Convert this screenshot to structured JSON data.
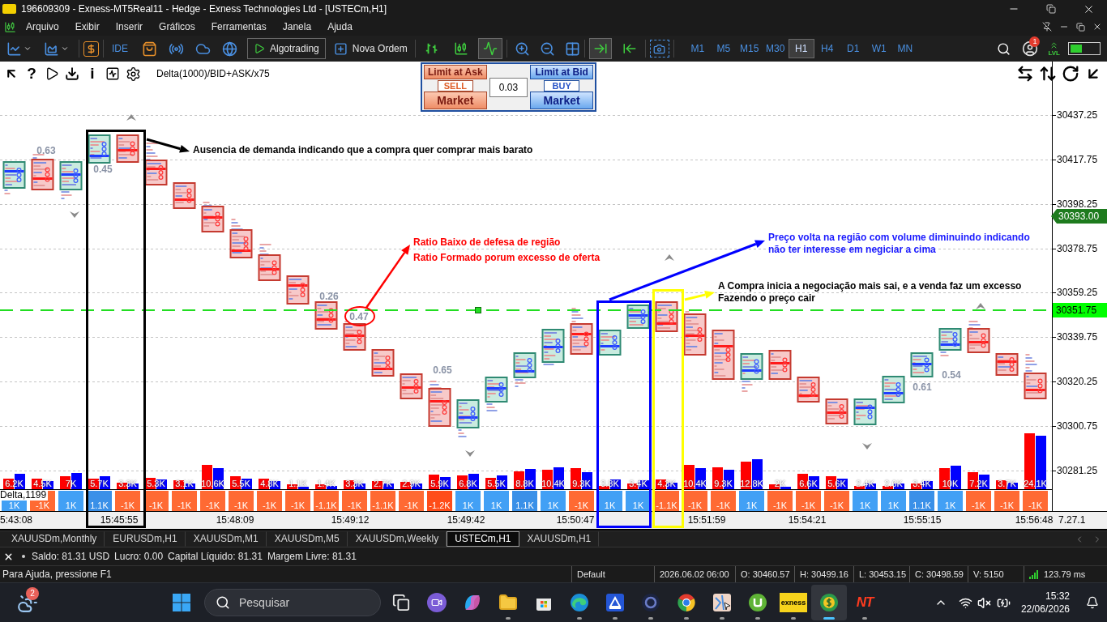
{
  "window": {
    "title": "196609309 - Exness-MT5Real11 - Hedge - Exness Technologies Ltd - [USTECm,H1]"
  },
  "menu": [
    "Arquivo",
    "Exibir",
    "Inserir",
    "Gráficos",
    "Ferramentas",
    "Janela",
    "Ajuda"
  ],
  "toolbar": {
    "ide": "IDE",
    "algotrading": "Algotrading",
    "new_order": "Nova Ordem",
    "chart_types": [
      {
        "kind": "bars",
        "selected": false
      },
      {
        "kind": "candles",
        "selected": false
      },
      {
        "kind": "line",
        "selected": true
      }
    ],
    "toggles": [
      {
        "kind": "shift",
        "selected": true
      },
      {
        "kind": "autoscroll",
        "selected": false
      }
    ],
    "timeframes": [
      {
        "label": "M1",
        "selected": false
      },
      {
        "label": "M5",
        "selected": false
      },
      {
        "label": "M15",
        "selected": false
      },
      {
        "label": "M30",
        "selected": false
      },
      {
        "label": "H1",
        "selected": true
      },
      {
        "label": "H4",
        "selected": false
      },
      {
        "label": "D1",
        "selected": false
      },
      {
        "label": "W1",
        "selected": false
      },
      {
        "label": "MN",
        "selected": false
      }
    ],
    "notification_count": "1",
    "level_label": "LVL"
  },
  "chart": {
    "help_glyph": "?",
    "info_glyph": "i",
    "indicator_label": "Delta(1000)/BID+ASK/x75",
    "trade_panel": {
      "sell_limit": "Limit at Ask",
      "sell": "SELL",
      "sell_market": "Market",
      "lot": "0.03",
      "buy_limit": "Limit at Bid",
      "buy": "BUY",
      "buy_market": "Market"
    },
    "price_axis": [
      {
        "label": "30437.25",
        "kind": "tick"
      },
      {
        "label": "30417.75",
        "kind": "tick"
      },
      {
        "label": "30398.25",
        "kind": "tick"
      },
      {
        "label": "30393.00",
        "kind": "bid"
      },
      {
        "label": "30378.75",
        "kind": "tick"
      },
      {
        "label": "30359.25",
        "kind": "tick"
      },
      {
        "label": "30351.75",
        "kind": "line"
      },
      {
        "label": "30339.75",
        "kind": "tick"
      },
      {
        "label": "30320.25",
        "kind": "tick"
      },
      {
        "label": "30300.75",
        "kind": "tick"
      },
      {
        "label": "30281.25",
        "kind": "tick"
      }
    ],
    "candles": [
      {
        "kind": "up"
      },
      {
        "kind": "down",
        "ratio": "0.63"
      },
      {
        "kind": "up"
      },
      {
        "kind": "up",
        "ratio": "0.45"
      },
      {
        "kind": "down"
      },
      {
        "kind": "down"
      },
      {
        "kind": "down"
      },
      {
        "kind": "down"
      },
      {
        "kind": "down"
      },
      {
        "kind": "down"
      },
      {
        "kind": "down"
      },
      {
        "kind": "down",
        "ratio": "0.26"
      },
      {
        "kind": "down",
        "ratio": "0.47"
      },
      {
        "kind": "down"
      },
      {
        "kind": "down"
      },
      {
        "kind": "down",
        "ratio": "0.65"
      },
      {
        "kind": "up"
      },
      {
        "kind": "up"
      },
      {
        "kind": "up"
      },
      {
        "kind": "up"
      },
      {
        "kind": "down"
      },
      {
        "kind": "up"
      },
      {
        "kind": "up"
      },
      {
        "kind": "down"
      },
      {
        "kind": "down"
      },
      {
        "kind": "down"
      },
      {
        "kind": "up"
      },
      {
        "kind": "down"
      },
      {
        "kind": "down"
      },
      {
        "kind": "down"
      },
      {
        "kind": "up"
      },
      {
        "kind": "up"
      },
      {
        "kind": "up",
        "ratio": "0.61"
      },
      {
        "kind": "up",
        "ratio": "0.54"
      },
      {
        "kind": "down"
      },
      {
        "kind": "down"
      },
      {
        "kind": "down"
      }
    ],
    "signals": [
      {
        "kind": "down"
      },
      {
        "kind": "up"
      },
      {
        "kind": "down"
      },
      {
        "kind": "up"
      },
      {
        "kind": "down"
      },
      {
        "kind": "up"
      }
    ],
    "annotations": [
      {
        "lines": [
          "Ausencia de demanda indicando que a compra quer comprar mais barato"
        ],
        "color": "#000000"
      },
      {
        "lines": [
          "Ratio Baixo de defesa de região",
          "Ratio Formado porum excesso de oferta"
        ],
        "color": "#ff0000"
      },
      {
        "lines": [
          "Preço volta na região com volume diminuindo indicando",
          "não ter interesse em negiciar a cima"
        ],
        "color": "#1a1aff"
      },
      {
        "lines": [
          "A Compra inicia a negociação mais sai, e a venda faz um excesso",
          "Fazendo o preço cair"
        ],
        "color": "#000000"
      }
    ],
    "volume": [
      {
        "label": "6.2K"
      },
      {
        "label": "4.5K"
      },
      {
        "label": "7K"
      },
      {
        "label": "5.7K"
      },
      {
        "label": "3.3K"
      },
      {
        "label": "5.3K"
      },
      {
        "label": "3.1K"
      },
      {
        "label": "10.6K"
      },
      {
        "label": "5.5K"
      },
      {
        "label": "4.8K"
      },
      {
        "label": "1.1K"
      },
      {
        "label": "1.4K"
      },
      {
        "label": "3.3K"
      },
      {
        "label": "2.7K"
      },
      {
        "label": "2.9K"
      },
      {
        "label": "5.9K"
      },
      {
        "label": "6.8K"
      },
      {
        "label": "5.5K"
      },
      {
        "label": "8.8K"
      },
      {
        "label": "10.4K"
      },
      {
        "label": "9.3K"
      },
      {
        "label": "3.8K"
      },
      {
        "label": "3.4K"
      },
      {
        "label": "4.3K"
      },
      {
        "label": "10.4K"
      },
      {
        "label": "9.3K"
      },
      {
        "label": "12.8K"
      },
      {
        "label": "2K"
      },
      {
        "label": "6.6K"
      },
      {
        "label": "5.6K"
      },
      {
        "label": "2.4K"
      },
      {
        "label": "2.6K"
      },
      {
        "label": "3.4K"
      },
      {
        "label": "10K"
      },
      {
        "label": "7.2K"
      },
      {
        "label": "3.7K"
      },
      {
        "label": "24.1K"
      }
    ],
    "delta_label": "Delta,1199",
    "delta": [
      {
        "label": "1K",
        "color": "#42a0f5"
      },
      {
        "label": "-1K",
        "color": "#ff6a33"
      },
      {
        "label": "1K",
        "color": "#42a0f5"
      },
      {
        "label": "1.1K",
        "color": "#3a90e8"
      },
      {
        "label": "-1K",
        "color": "#ff6a33"
      },
      {
        "label": "-1K",
        "color": "#ff6a33"
      },
      {
        "label": "-1K",
        "color": "#ff6a33"
      },
      {
        "label": "-1K",
        "color": "#ff6a33"
      },
      {
        "label": "-1K",
        "color": "#ff6a33"
      },
      {
        "label": "-1K",
        "color": "#ff6a33"
      },
      {
        "label": "-1K",
        "color": "#ff6a33"
      },
      {
        "label": "-1.1K",
        "color": "#ff6a33"
      },
      {
        "label": "-1K",
        "color": "#ff6a33"
      },
      {
        "label": "-1.1K",
        "color": "#ff6a33"
      },
      {
        "label": "-1K",
        "color": "#ff6a33"
      },
      {
        "label": "-1.2K",
        "color": "#ff4d1a"
      },
      {
        "label": "1K",
        "color": "#42a0f5"
      },
      {
        "label": "1K",
        "color": "#42a0f5"
      },
      {
        "label": "1.1K",
        "color": "#3a90e8"
      },
      {
        "label": "1K",
        "color": "#42a0f5"
      },
      {
        "label": "-1K",
        "color": "#ff6a33"
      },
      {
        "label": "1K",
        "color": "#42a0f5"
      },
      {
        "label": "1K",
        "color": "#42a0f5"
      },
      {
        "label": "-1.1K",
        "color": "#ff6a33"
      },
      {
        "label": "-1K",
        "color": "#ff6a33"
      },
      {
        "label": "-1K",
        "color": "#ff6a33"
      },
      {
        "label": "1K",
        "color": "#42a0f5"
      },
      {
        "label": "-1K",
        "color": "#ff6a33"
      },
      {
        "label": "-1K",
        "color": "#ff6a33"
      },
      {
        "label": "-1K",
        "color": "#ff6a33"
      },
      {
        "label": "1K",
        "color": "#42a0f5"
      },
      {
        "label": "1K",
        "color": "#42a0f5"
      },
      {
        "label": "1.1K",
        "color": "#3a90e8"
      },
      {
        "label": "1K",
        "color": "#42a0f5"
      },
      {
        "label": "-1K",
        "color": "#ff6a33"
      },
      {
        "label": "-1K",
        "color": "#ff6a33"
      },
      {
        "label": "-1K",
        "color": "#ff6a33"
      }
    ],
    "time_axis": [
      "5:43:08",
      "15:45:55",
      "15:48:09",
      "15:49:12",
      "15:49:42",
      "15:50:47",
      "15:51:59",
      "15:54:21",
      "15:55:15",
      "15:56:48"
    ],
    "build": "7.27.1"
  },
  "chart_tabs": [
    {
      "label": "XAUUSDm,Monthly",
      "selected": false
    },
    {
      "label": "EURUSDm,H1",
      "selected": false
    },
    {
      "label": "XAUUSDm,M1",
      "selected": false
    },
    {
      "label": "XAUUSDm,M5",
      "selected": false
    },
    {
      "label": "XAUUSDm,Weekly",
      "selected": false
    },
    {
      "label": "USTECm,H1",
      "selected": true
    },
    {
      "label": "XAUUSDm,H1",
      "selected": false
    }
  ],
  "account_bar": [
    "Saldo: 81.31 USD",
    "Lucro: 0.00",
    "Capital Líquido: 81.31",
    "Margem Livre: 81.31"
  ],
  "status_bar": {
    "help": "Para Ajuda, pressione F1",
    "profile": "Default",
    "datetime": "2026.06.02 06:00",
    "open": "O: 30460.57",
    "high": "H: 30499.16",
    "low": "L: 30453.15",
    "close": "C: 30498.59",
    "volume": "V: 5150",
    "ping": "123.79 ms"
  },
  "taskbar": {
    "weather_badge": "2",
    "search_placeholder": "Pesquisar",
    "apps": [
      {
        "kind": "panes",
        "running": false,
        "selected": false
      },
      {
        "kind": "camera",
        "running": false,
        "selected": false
      },
      {
        "kind": "swirl",
        "running": false,
        "selected": false
      },
      {
        "kind": "folder",
        "running": true,
        "selected": false
      },
      {
        "kind": "bag",
        "running": false,
        "selected": false
      },
      {
        "kind": "wave",
        "running": true,
        "selected": false
      },
      {
        "kind": "scanner",
        "running": true,
        "selected": false
      },
      {
        "kind": "ring",
        "running": true,
        "selected": false
      },
      {
        "kind": "wheel",
        "running": true,
        "selected": false
      },
      {
        "kind": "map",
        "running": true,
        "selected": false
      },
      {
        "kind": "ucircle",
        "running": true,
        "selected": false
      },
      {
        "kind": "logo",
        "text": "exness",
        "running": true,
        "selected": false
      },
      {
        "kind": "coin",
        "running": true,
        "selected": true
      },
      {
        "kind": "letters",
        "text": "NT",
        "running": true,
        "selected": false
      }
    ],
    "time": "15:32",
    "date": "22/06/2026"
  }
}
